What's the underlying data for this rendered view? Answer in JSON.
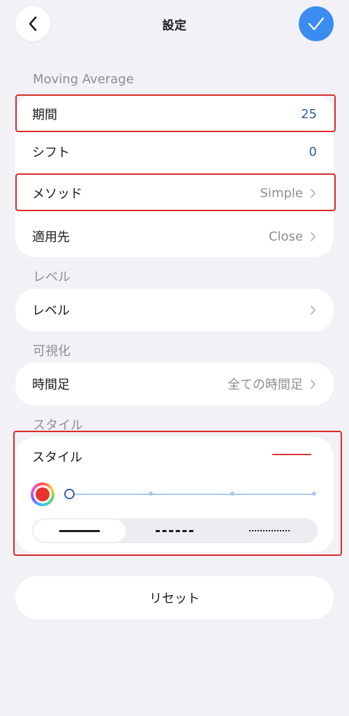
{
  "header": {
    "title": "設定",
    "back_icon": "chevron-left-icon",
    "confirm_icon": "checkmark-icon",
    "confirm_color": "#3b8cf0"
  },
  "sections": {
    "moving_average": {
      "label": "Moving Average",
      "rows": [
        {
          "label": "期間",
          "value": "25"
        },
        {
          "label": "シフト",
          "value": "0"
        },
        {
          "label": "メソッド",
          "value": "Simple"
        },
        {
          "label": "適用先",
          "value": "Close"
        }
      ]
    },
    "levels": {
      "label": "レベル",
      "row_label": "レベル"
    },
    "visualization": {
      "label": "可視化",
      "row_label": "時間足",
      "row_value": "全ての時間足"
    },
    "style": {
      "label": "スタイル",
      "row_label": "スタイル",
      "line_color": "#d93a32",
      "selected_color": "#e8332e",
      "thickness_level": 0,
      "thickness_steps": 4,
      "line_types": [
        "solid",
        "dashed",
        "dotted"
      ],
      "selected_line_type": "solid"
    }
  },
  "reset_label": "リセット",
  "highlight_color": "#d92b2b"
}
